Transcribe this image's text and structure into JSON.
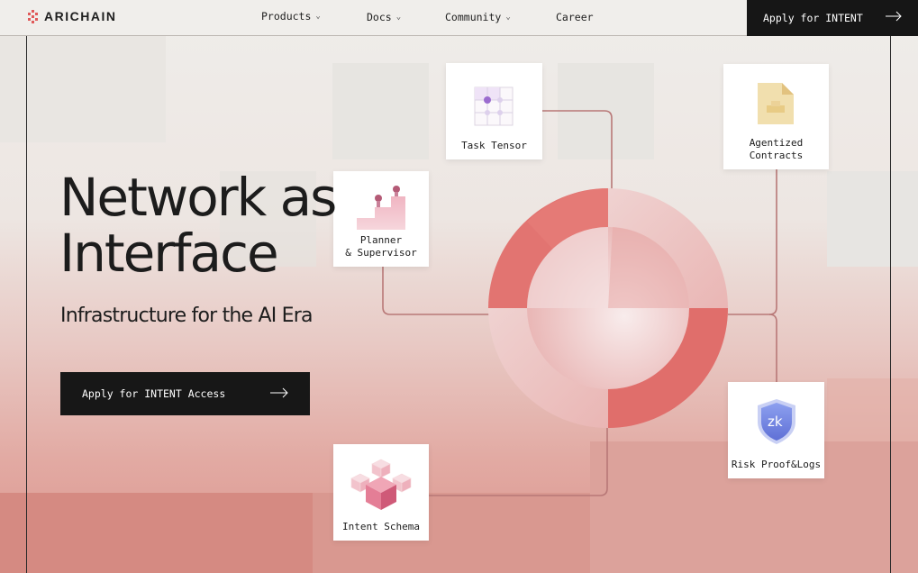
{
  "brand": {
    "name": "ARICHAIN",
    "accent": "#e05a5a"
  },
  "nav": {
    "items": [
      {
        "label": "Products",
        "has_dropdown": true
      },
      {
        "label": "Docs",
        "has_dropdown": true
      },
      {
        "label": "Community",
        "has_dropdown": true
      },
      {
        "label": "Career",
        "has_dropdown": false
      }
    ],
    "apply_label": "Apply for INTENT"
  },
  "hero": {
    "title_line1": "Network as",
    "title_line2": "Interface",
    "subtitle": "Infrastructure for the AI Era",
    "cta_label": "Apply for INTENT Access"
  },
  "diagram": {
    "cards": [
      {
        "id": "task-tensor",
        "label": "Task Tensor",
        "icon": "grid-icon"
      },
      {
        "id": "agentized-contracts",
        "label": "Agentized\nContracts",
        "icon": "document-icon"
      },
      {
        "id": "planner-supervisor",
        "label": "Planner\n& Supervisor",
        "icon": "steps-icon"
      },
      {
        "id": "risk-proof-logs",
        "label": "Risk Proof&Logs",
        "icon": "zk-shield-icon",
        "badge": "zk"
      },
      {
        "id": "intent-schema",
        "label": "Intent Schema",
        "icon": "cubes-icon"
      }
    ],
    "ring_colors": {
      "dark": "#e06f6c",
      "light": "#efc4c2"
    }
  }
}
